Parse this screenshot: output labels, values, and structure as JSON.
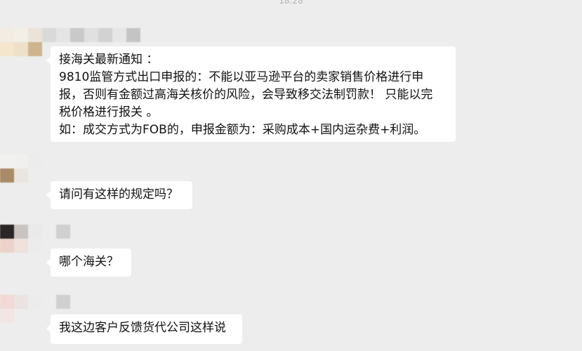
{
  "timestamp": "18:28",
  "messages": [
    {
      "lines": [
        "接海关最新通知 ：",
        "9810监管方式出口申报的：不能以亚马逊平台的卖家销售价格进行申",
        "报，否则有金额过高海关核价的风险，会导致移交法制罚款！ 只能以完",
        "税价格进行报关 。",
        "如：成交方式为FOB的，申报金额为：采购成本+国内运杂费+利润。"
      ]
    },
    {
      "lines": [
        "请问有这样的规定吗？"
      ]
    },
    {
      "lines": [
        "哪个海关？"
      ]
    },
    {
      "lines": [
        "我这边客户反馈货代公司这样说"
      ]
    }
  ],
  "colors": {
    "background": "#ededed",
    "bubble": "#ffffff",
    "timestamp": "#b2b2b2"
  }
}
